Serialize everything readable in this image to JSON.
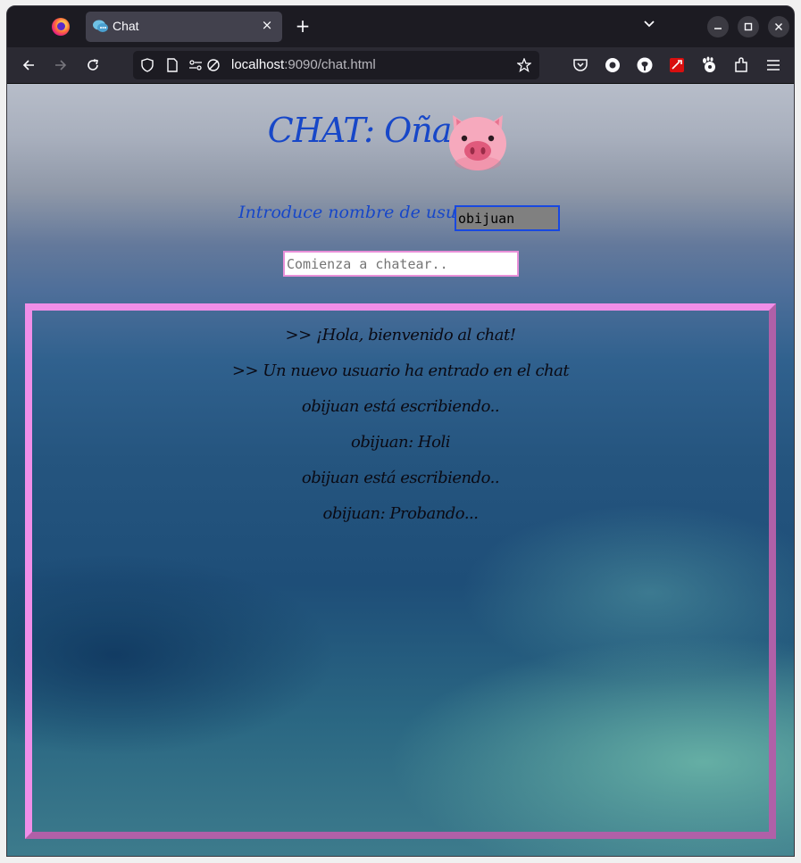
{
  "browser": {
    "tab_title": "Chat",
    "tab_close": "×",
    "new_tab": "+",
    "url_host": "localhost",
    "url_rest": ":9090/chat.html",
    "icons": [
      "back-icon",
      "forward-icon",
      "reload-icon",
      "shield-icon",
      "page-icon",
      "permissions-icon",
      "tracking-off-icon",
      "bookmark-star-icon",
      "pocket-icon",
      "extension-disc-icon",
      "github-icon",
      "extension-red-icon",
      "gnome-icon",
      "extensions-icon",
      "menu-icon"
    ]
  },
  "page": {
    "title": "CHAT: Oña",
    "username_label": "Introduce nombre de usuario:",
    "username_value": "obijuan",
    "message_placeholder": "Comienza a chatear..",
    "messages": [
      ">> ¡Hola, bienvenido al chat!",
      ">> Un nuevo usuario ha entrado en el chat",
      "obijuan está escribiendo..",
      "obijuan: Holi",
      "obijuan está escribiendo..",
      "obijuan: Probando..."
    ]
  },
  "colors": {
    "title": "#1747c8",
    "chat_border_light": "#f08ee8",
    "chat_border_dark": "#b060a8",
    "username_input_bg": "#808080",
    "username_input_border": "#1848e0"
  }
}
